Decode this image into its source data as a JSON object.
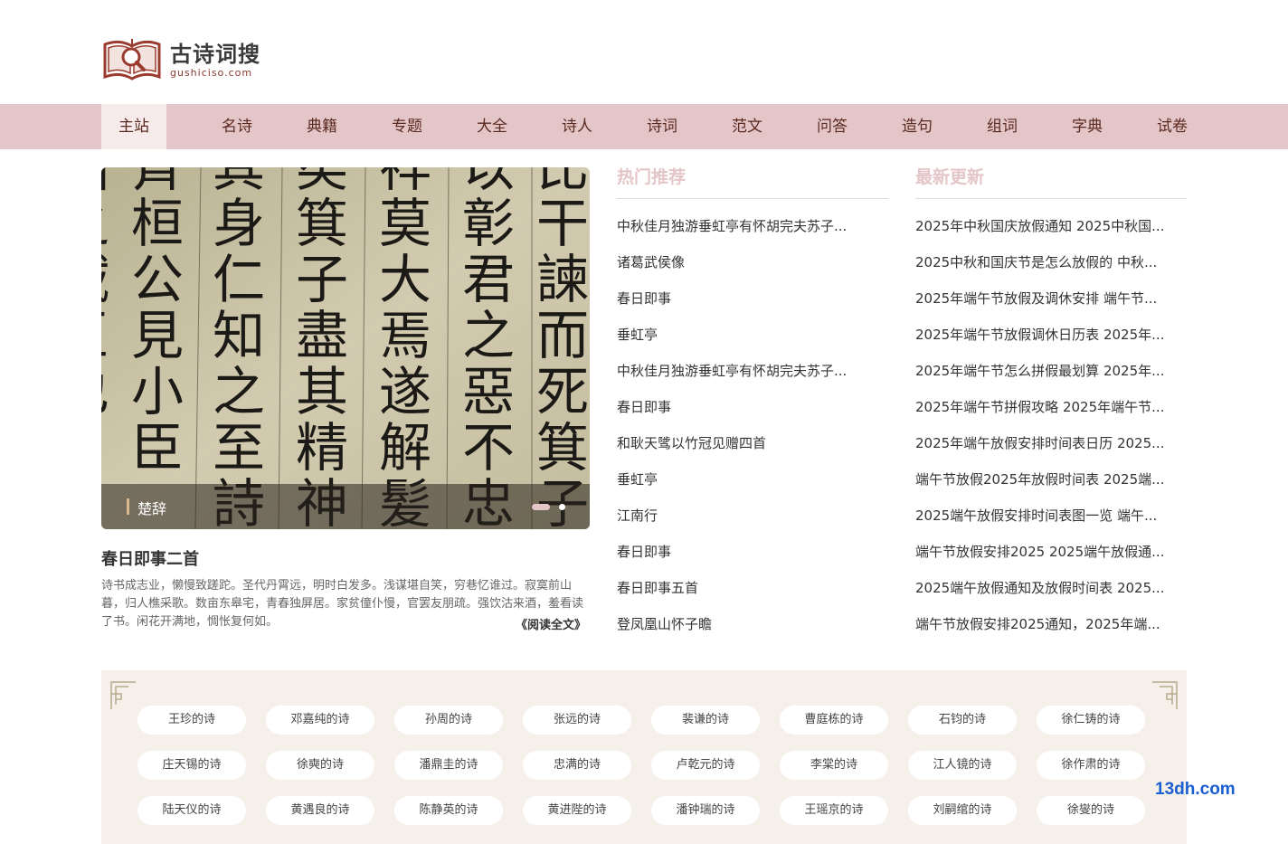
{
  "logo": {
    "title": "古诗词搜",
    "subtitle": "gushiciso.com"
  },
  "nav": [
    {
      "label": "主站"
    },
    {
      "label": "名诗"
    },
    {
      "label": "典籍"
    },
    {
      "label": "专题"
    },
    {
      "label": "大全"
    },
    {
      "label": "诗人"
    },
    {
      "label": "诗词"
    },
    {
      "label": "范文"
    },
    {
      "label": "问答"
    },
    {
      "label": "造句"
    },
    {
      "label": "组词"
    },
    {
      "label": "字典"
    },
    {
      "label": "试卷"
    }
  ],
  "slider": {
    "caption": "楚辞",
    "image_text_columns": [
      "比干諫而死箕子",
      "以彰君之惡不忠",
      "祥莫大焉遂解髪",
      "矣箕子盡其精神",
      "其身仁知之至詩",
      "齊桓公見小臣",
      "國之賊臣也"
    ]
  },
  "feature": {
    "title": "春日即事二首",
    "body": "诗书成志业，懒慢致蹉跎。圣代丹霄远，明时白发多。浅谋堪自笑，穷巷忆谁过。寂寞前山暮，归人樵采歌。数亩东皋宅，青春独屏居。家贫僮仆慢，官罢友朋疏。强饮沽来酒，羞看读了书。闲花开满地，惆怅复何如。",
    "read_more": "《阅读全文》"
  },
  "hot": {
    "title": "热门推荐",
    "items": [
      "中秋佳月独游垂虹亭有怀胡完夫苏子...",
      "诸葛武侯像",
      "春日即事",
      "垂虹亭",
      "中秋佳月独游垂虹亭有怀胡完夫苏子...",
      "春日即事",
      "和耿天骘以竹冠见赠四首",
      "垂虹亭",
      "江南行",
      "春日即事",
      "春日即事五首",
      "登凤凰山怀子瞻"
    ]
  },
  "latest": {
    "title": "最新更新",
    "items": [
      "2025年中秋国庆放假通知 2025中秋国...",
      "2025中秋和国庆节是怎么放假的 中秋...",
      "2025年端午节放假及调休安排 端午节...",
      "2025年端午节放假调休日历表 2025年...",
      "2025年端午节怎么拼假最划算 2025年...",
      "2025年端午节拼假攻略 2025年端午节...",
      "2025年端午放假安排时间表日历 2025...",
      "端午节放假2025年放假时间表 2025端...",
      "2025端午放假安排时间表图一览 端午...",
      "端午节放假安排2025 2025端午放假通...",
      "2025端午放假通知及放假时间表 2025...",
      "端午节放假安排2025通知，2025年端..."
    ]
  },
  "tags": [
    "王珍的诗",
    "邓嘉纯的诗",
    "孙周的诗",
    "张远的诗",
    "裴谦的诗",
    "曹庭栋的诗",
    "石钧的诗",
    "徐仁铸的诗",
    "庄天锡的诗",
    "徐奭的诗",
    "潘鼎圭的诗",
    "忠满的诗",
    "卢乾元的诗",
    "李棠的诗",
    "江人镜的诗",
    "徐作肃的诗",
    "陆天仪的诗",
    "黄遇良的诗",
    "陈静英的诗",
    "黄进陛的诗",
    "潘钟瑞的诗",
    "王瑶京的诗",
    "刘嗣绾的诗",
    "徐燮的诗"
  ],
  "watermark": "13dh.com",
  "colors": {
    "nav_bg": "#e4c6c8",
    "nav_active_bg": "#f6eaea",
    "nav_text": "#5a2a20",
    "section_title": "#e4c6c8",
    "tags_bg": "#f5f1ea",
    "logo_red": "#9b3a2e",
    "watermark": "#1a5fd1"
  }
}
